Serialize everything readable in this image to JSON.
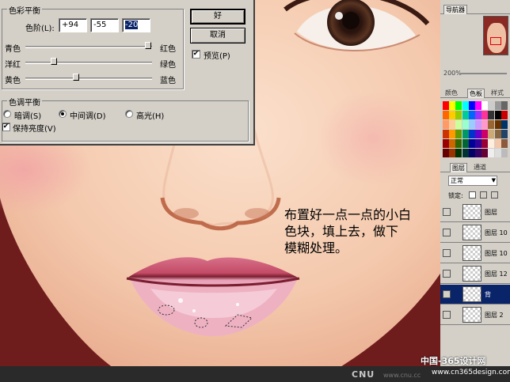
{
  "dialog": {
    "group_balance_title": "色彩平衡",
    "levels_label": "色阶(L):",
    "levels": [
      "+94",
      "-55",
      "-20"
    ],
    "sliders": [
      {
        "left": "青色",
        "right": "红色",
        "value": 94
      },
      {
        "left": "洋红",
        "right": "绿色",
        "value": -55
      },
      {
        "left": "黄色",
        "right": "蓝色",
        "value": -20
      }
    ],
    "group_tone_title": "色调平衡",
    "tones": [
      {
        "label": "暗调(S)",
        "selected": false
      },
      {
        "label": "中间调(D)",
        "selected": true
      },
      {
        "label": "高光(H)",
        "selected": false
      }
    ],
    "preserve_luminosity": "保持亮度(V)",
    "ok": "好",
    "cancel": "取消",
    "preview": "预览(P)"
  },
  "annotation": {
    "line1": "布置好一点一点的小白",
    "line2": "色块，填上去，做下",
    "line3": "模糊处理。"
  },
  "panels": {
    "navigator_tab": "导航器",
    "zoom": "200%",
    "color_tabs": [
      "颜色",
      "色板",
      "样式"
    ],
    "layers_tabs": [
      "图层",
      "通道"
    ],
    "blend_mode": "正常",
    "lock_label": "锁定:",
    "layers": [
      {
        "name": "图层",
        "selected": false
      },
      {
        "name": "图层 10",
        "selected": false
      },
      {
        "name": "图层 10",
        "selected": false
      },
      {
        "name": "图层 12",
        "selected": false
      },
      {
        "name": "背",
        "selected": true
      },
      {
        "name": "图层 2",
        "selected": false
      }
    ]
  },
  "watermark": {
    "cnu": "CNU",
    "site_cn": "中国-365设计网",
    "site_en": "www.cn365design.com",
    "site_small": "www.cnu.cc"
  },
  "colors": {
    "skin": "#f4c9ad",
    "background": "#6e1c1c",
    "lips": "#e8a0b0",
    "dialog": "#d4d0c8",
    "selection": "#0a246a"
  }
}
